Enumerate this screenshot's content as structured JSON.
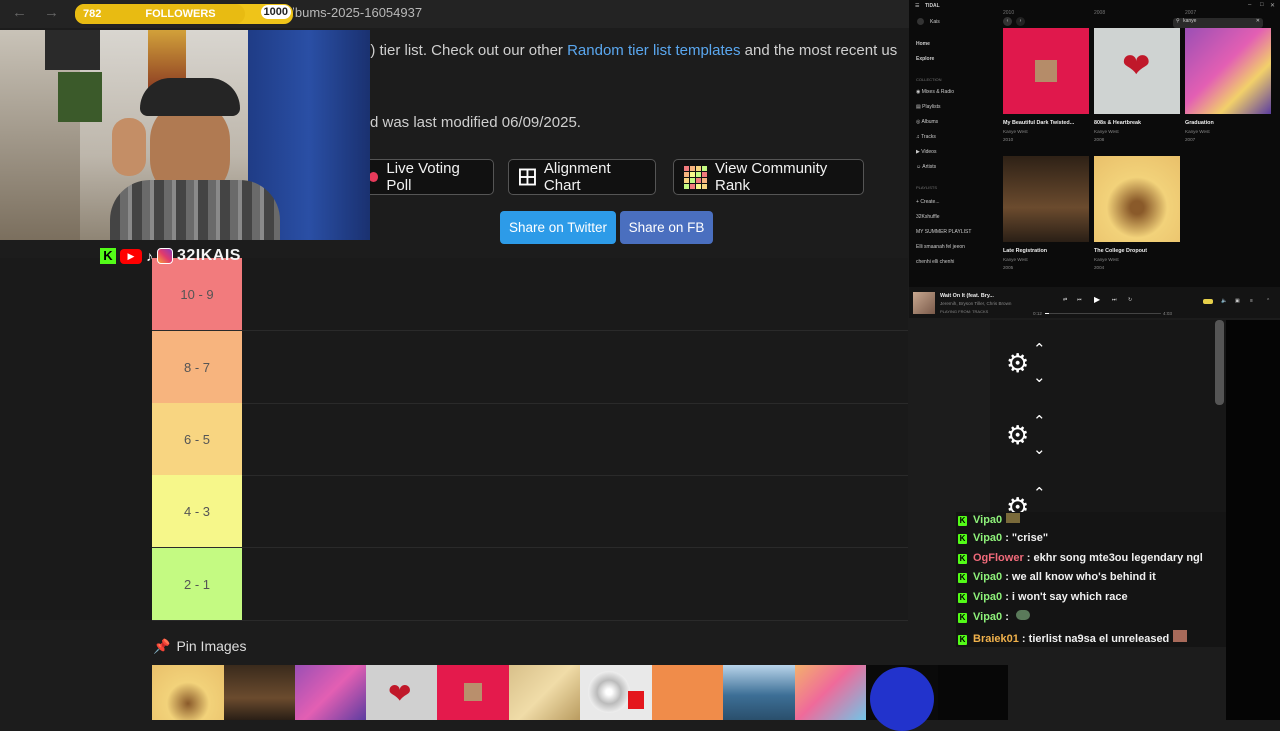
{
  "browser": {
    "url_fragment": "nye-albums-2025-16054937"
  },
  "followers": {
    "current": "782",
    "label": "FOLLOWERS",
    "goal": "1000",
    "progress": 0.782
  },
  "page": {
    "intro_prefix": "5) tier list. Check out our other ",
    "intro_link": "Random tier list templates",
    "intro_suffix": " and the most recent us",
    "modified_text": "d was last modified 06/09/2025.",
    "buttons": {
      "poll": "Live Voting Poll",
      "alignment": "Alignment Chart",
      "community": "View Community Rank"
    },
    "share": {
      "twitter": "Share on Twitter",
      "fb": "Share on FB"
    },
    "tiers": [
      {
        "label": "10 - 9",
        "color": "#f27b7d"
      },
      {
        "label": "8 - 7",
        "color": "#f7b47e"
      },
      {
        "label": "6 - 5",
        "color": "#f8d581"
      },
      {
        "label": "4 - 3",
        "color": "#f6f78a"
      },
      {
        "label": "2 - 1",
        "color": "#c4fa82"
      }
    ],
    "pin_label": "Pin Images"
  },
  "social": {
    "handle": "32IKAIS"
  },
  "tidal": {
    "app": "TIDAL",
    "user": "Kais",
    "search": "kanye",
    "years": [
      "2010",
      "2008",
      "2007"
    ],
    "nav": [
      "Home",
      "Explore"
    ],
    "collection_label": "COLLECTION",
    "collection": [
      "Mixes & Radio",
      "Playlists",
      "Albums",
      "Tracks",
      "Videos",
      "Artists"
    ],
    "playlists_label": "PLAYLISTS",
    "playlists": [
      "Create...",
      "32Kshuffle",
      "MY SUMMER PLAYLIST",
      "Elli smaanah fel jeeon",
      "chenhi elli chenhi"
    ],
    "albums": [
      {
        "title": "My Beautiful Dark Twisted...",
        "artist": "Kanye West",
        "year": "2010"
      },
      {
        "title": "808s & Heartbreak",
        "artist": "Kanye West",
        "year": "2008"
      },
      {
        "title": "Graduation",
        "artist": "Kanye West",
        "year": "2007"
      },
      {
        "title": "Late Registration",
        "artist": "Kanye West",
        "year": "2005"
      },
      {
        "title": "The College Dropout",
        "artist": "Kanye West",
        "year": "2004"
      }
    ],
    "now_playing": {
      "title": "Wait On It (feat. Bry...",
      "artists": "Jeremih, Bryson Tiller, Chris Brown",
      "source": "PLAYING FROM: TRACKS",
      "elapsed": "0:12",
      "total": "4:03"
    }
  },
  "chat": [
    {
      "user": "Vipa0",
      "color": "#8ef17a",
      "msg": ""
    },
    {
      "user": "Vipa0",
      "color": "#8ef17a",
      "msg": " : \"crise\""
    },
    {
      "user": "OgFlower",
      "color": "#f06a7a",
      "msg": " : ekhr song mte3ou legendary ngl"
    },
    {
      "user": "Vipa0",
      "color": "#8ef17a",
      "msg": " : we all know who's behind it"
    },
    {
      "user": "Vipa0",
      "color": "#8ef17a",
      "msg": " : i won't say which race"
    },
    {
      "user": "Vipa0",
      "color": "#8ef17a",
      "msg": " : "
    },
    {
      "user": "Braiek01",
      "color": "#f0b14b",
      "msg": " : tierlist na9sa el unreleased"
    }
  ]
}
